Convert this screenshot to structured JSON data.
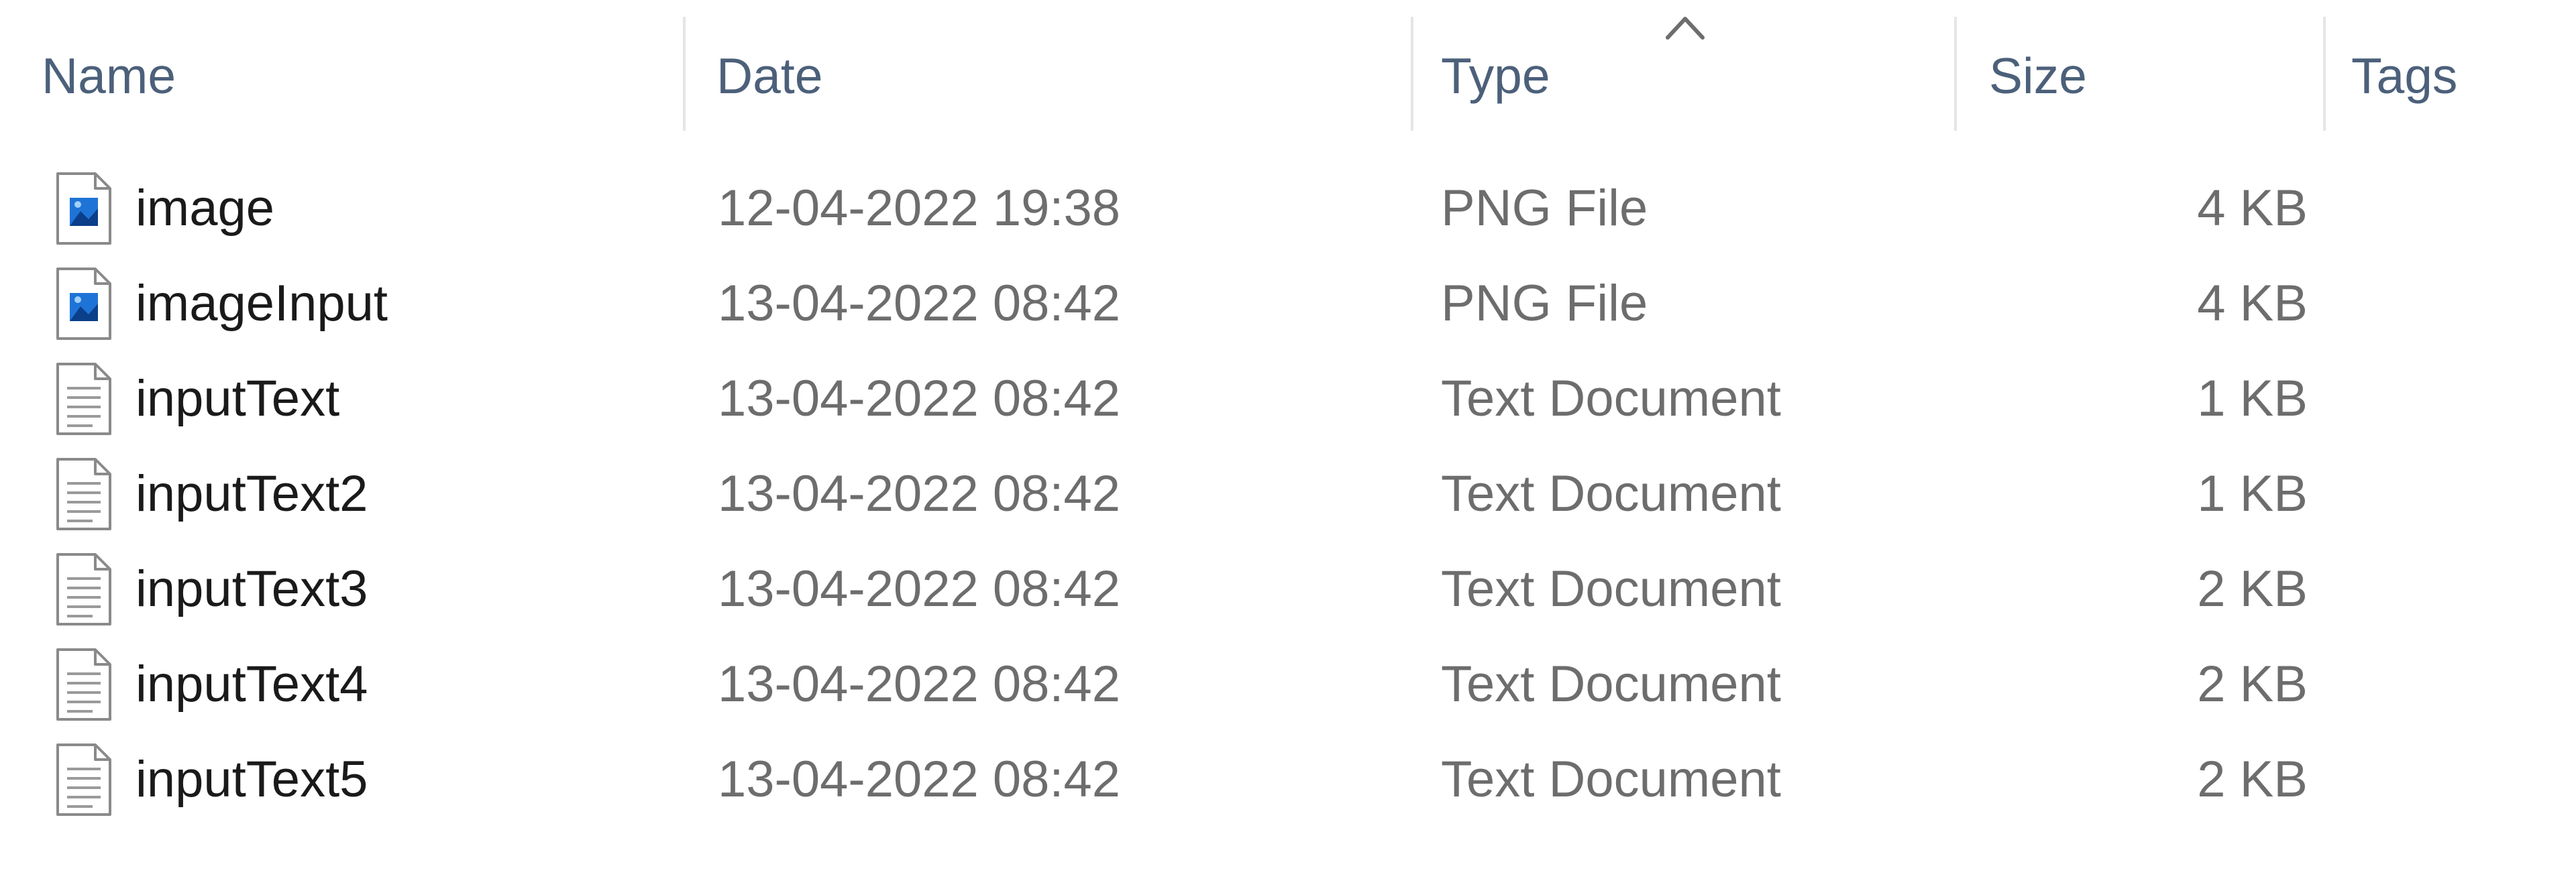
{
  "columns": {
    "name": "Name",
    "date": "Date",
    "type": "Type",
    "size": "Size",
    "tags": "Tags"
  },
  "sort": {
    "column": "type",
    "direction": "ascending",
    "icon": "chevron-up-icon"
  },
  "files": [
    {
      "name": "image",
      "date": "12-04-2022 19:38",
      "type": "PNG File",
      "size": "4 KB",
      "icon": "png-file-icon"
    },
    {
      "name": "imageInput",
      "date": "13-04-2022 08:42",
      "type": "PNG File",
      "size": "4 KB",
      "icon": "png-file-icon"
    },
    {
      "name": "inputText",
      "date": "13-04-2022 08:42",
      "type": "Text Document",
      "size": "1 KB",
      "icon": "text-file-icon"
    },
    {
      "name": "inputText2",
      "date": "13-04-2022 08:42",
      "type": "Text Document",
      "size": "1 KB",
      "icon": "text-file-icon"
    },
    {
      "name": "inputText3",
      "date": "13-04-2022 08:42",
      "type": "Text Document",
      "size": "2 KB",
      "icon": "text-file-icon"
    },
    {
      "name": "inputText4",
      "date": "13-04-2022 08:42",
      "type": "Text Document",
      "size": "2 KB",
      "icon": "text-file-icon"
    },
    {
      "name": "inputText5",
      "date": "13-04-2022 08:42",
      "type": "Text Document",
      "size": "2 KB",
      "icon": "text-file-icon"
    }
  ],
  "colors": {
    "header_text": "#4c607a",
    "name_text": "#1a1a1a",
    "detail_text": "#6d6d6d",
    "column_separator": "#e5e5e5",
    "png_icon_accent": "#1e73d6"
  }
}
